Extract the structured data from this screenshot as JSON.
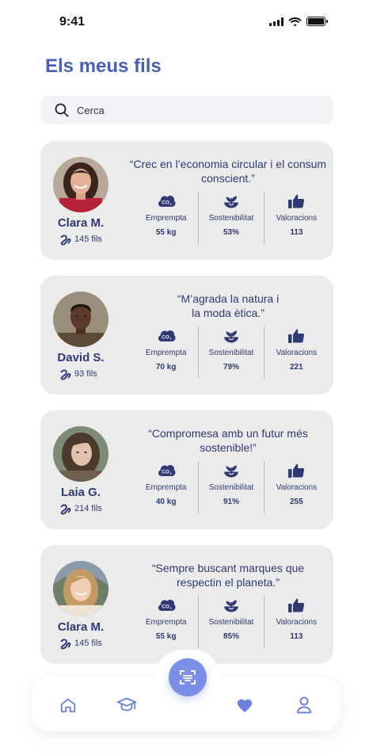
{
  "status_bar": {
    "time": "9:41"
  },
  "header": {
    "title": "Els meus fils"
  },
  "search": {
    "placeholder": "Cerca"
  },
  "stat_labels": {
    "footprint": "Emprempta",
    "sustainability": "Sostenibilitat",
    "ratings": "Valoracions"
  },
  "cards": [
    {
      "name": "Clara M.",
      "threads": "145 fils",
      "quote": "“Crec en l’economia circular i el consum conscient.”",
      "footprint": "55 kg",
      "sustainability": "53%",
      "ratings": "113"
    },
    {
      "name": "David S.",
      "threads": "93 fils",
      "quote": "“M’agrada la natura i la moda ètica.”",
      "footprint": "70 kg",
      "sustainability": "79%",
      "ratings": "221"
    },
    {
      "name": "Laia G.",
      "threads": "214 fils",
      "quote": "“Compromesa amb un futur més sostenible!”",
      "footprint": "40 kg",
      "sustainability": "91%",
      "ratings": "255"
    },
    {
      "name": "Clara M.",
      "threads": "145 fils",
      "quote": "“Sempre buscant marques que respectin el planeta.”",
      "footprint": "55 kg",
      "sustainability": "85%",
      "ratings": "113"
    }
  ],
  "colors": {
    "title": "#4a5fb5",
    "text": "#2f3a73",
    "card_bg": "#ebebeb",
    "accent": "#7b8ee8"
  },
  "nav": {
    "items": [
      "home-icon",
      "graduation-cap-icon",
      "scan-icon",
      "heart-icon",
      "user-icon"
    ]
  }
}
